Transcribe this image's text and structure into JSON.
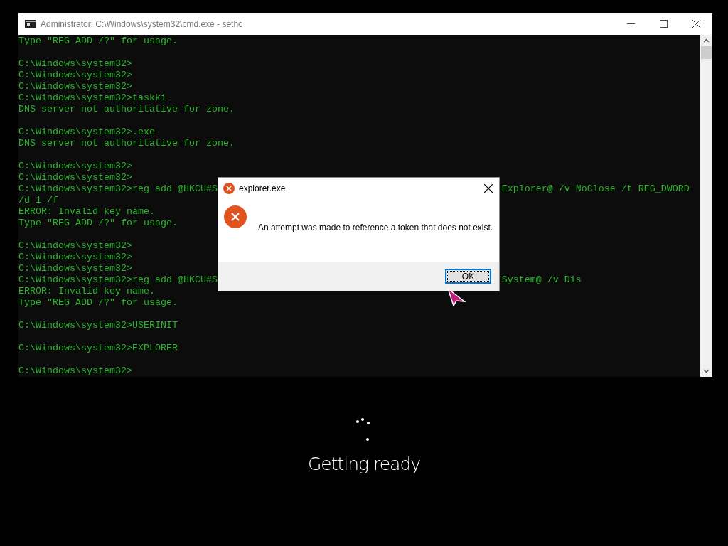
{
  "console_window": {
    "title": "Administrator: C:\\Windows\\system32\\cmd.exe - sethc",
    "lines": [
      {
        "kind": "text",
        "text": "Type \"REG ADD /?\" for usage."
      },
      {
        "kind": "blank"
      },
      {
        "kind": "text",
        "text": "C:\\Windows\\system32>"
      },
      {
        "kind": "text",
        "text": "C:\\Windows\\system32>"
      },
      {
        "kind": "text",
        "text": "C:\\Windows\\system32>"
      },
      {
        "kind": "text",
        "text": "C:\\Windows\\system32>taskki"
      },
      {
        "kind": "text",
        "text": "DNS server not authoritative for zone."
      },
      {
        "kind": "blank"
      },
      {
        "kind": "text",
        "text": "C:\\Windows\\system32>.exe"
      },
      {
        "kind": "text",
        "text": "DNS server not authoritative for zone."
      },
      {
        "kind": "blank"
      },
      {
        "kind": "text",
        "text": "C:\\Windows\\system32>"
      },
      {
        "kind": "text",
        "text": "C:\\Windows\\system32>"
      },
      {
        "kind": "split",
        "left": "C:\\Windows\\system32>reg add @HKCU#S",
        "right": "Explorer@ /v NoClose /t REG_DWORD"
      },
      {
        "kind": "text",
        "text": "/d 1 /f"
      },
      {
        "kind": "text",
        "text": "ERROR: Invalid key name."
      },
      {
        "kind": "text",
        "text": "Type \"REG ADD /?\" for usage."
      },
      {
        "kind": "blank"
      },
      {
        "kind": "text",
        "text": "C:\\Windows\\system32>"
      },
      {
        "kind": "text",
        "text": "C:\\Windows\\system32>"
      },
      {
        "kind": "text",
        "text": "C:\\Windows\\system32>"
      },
      {
        "kind": "split",
        "left": "C:\\Windows\\system32>reg add @HKCU#S",
        "right": "System@ /v Dis"
      },
      {
        "kind": "text",
        "text": "ERROR: Invalid key name."
      },
      {
        "kind": "text",
        "text": "Type \"REG ADD /?\" for usage."
      },
      {
        "kind": "blank"
      },
      {
        "kind": "text",
        "text": "C:\\Windows\\system32>USERINIT"
      },
      {
        "kind": "blank"
      },
      {
        "kind": "text",
        "text": "C:\\Windows\\system32>EXPLORER"
      },
      {
        "kind": "blank"
      },
      {
        "kind": "text",
        "text": "C:\\Windows\\system32>"
      }
    ]
  },
  "error_dialog": {
    "title": "explorer.exe",
    "message": "An attempt was made to reference a token that does not exist.",
    "button": "OK"
  },
  "status": {
    "text": "Getting ready"
  }
}
